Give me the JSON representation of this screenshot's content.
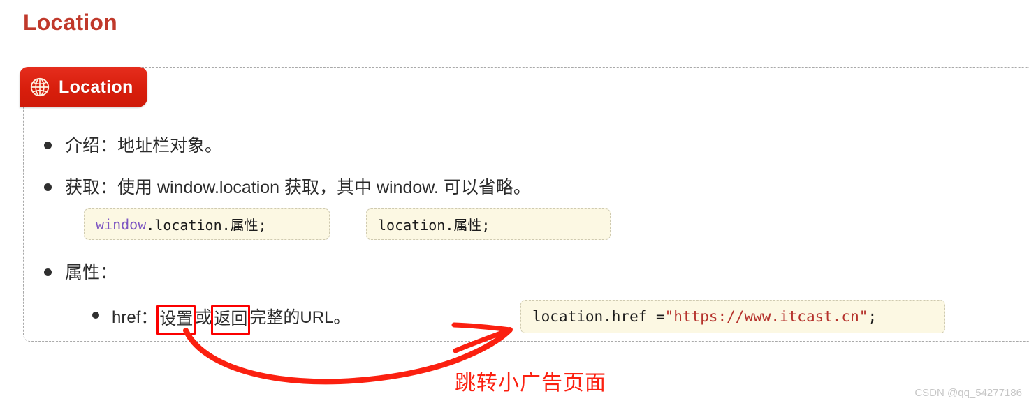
{
  "page": {
    "title": "Location",
    "watermark": "CSDN @qq_54277186"
  },
  "section": {
    "badge_label": "Location",
    "badge_icon": "globe-icon",
    "badge_color": "#d81e0c",
    "panel_border_style": "dashed"
  },
  "bullets": {
    "intro": {
      "text": "介绍：地址栏对象。"
    },
    "access": {
      "text": "获取：使用 window.location 获取，其中 window. 可以省略。"
    },
    "properties": {
      "text": "属性："
    },
    "href": {
      "prefix": "href：",
      "highlight_1": "设置",
      "between": "或",
      "highlight_2": "返回",
      "suffix": "完整的URL。",
      "highlight_color": "#fb0000"
    }
  },
  "code_samples": {
    "window_location": {
      "token_object": "window",
      "token_rest": ".location.属性;"
    },
    "location_short": {
      "text": "location.属性;"
    },
    "href_assign": {
      "lhs": "location.href = ",
      "url_string": "\"https://www.itcast.cn\"",
      "terminator": ";"
    },
    "chip_background": "#fcf8e3",
    "string_color": "#b5322c",
    "keyword_color": "#7e57c2"
  },
  "annotation": {
    "note": "跳转小广告页面",
    "color": "#fb2010",
    "shape": "curved-arrow"
  }
}
